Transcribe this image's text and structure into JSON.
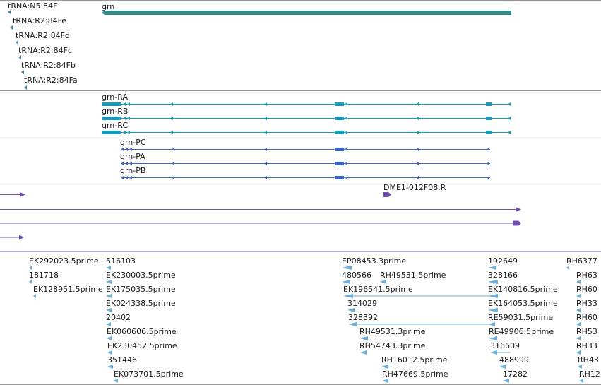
{
  "colors": {
    "trna": "#3a8fa0",
    "gene": "#2f8a8a",
    "transcript_r": "#1a9cb8",
    "transcript_p": "#3b66c0",
    "misc": "#6e4fb0",
    "est": "#6bb0d8",
    "divider": "#9a9a9a"
  },
  "trna_features": [
    {
      "label": "tRNA:N5:84F"
    },
    {
      "label": "tRNA:R2:84Fe"
    },
    {
      "label": "tRNA:R2:84Fd"
    },
    {
      "label": "tRNA:R2:84Fc"
    },
    {
      "label": "tRNA:R2:84Fb"
    },
    {
      "label": "tRNA:R2:84Fa"
    }
  ],
  "gene": {
    "label": "grn"
  },
  "transcripts_r": [
    {
      "label": "grn-RA"
    },
    {
      "label": "grn-RB"
    },
    {
      "label": "grn-RC"
    }
  ],
  "transcripts_p": [
    {
      "label": "grn-PC"
    },
    {
      "label": "grn-PA"
    },
    {
      "label": "grn-PB"
    }
  ],
  "misc_features": [
    {
      "label": "DME1-012F08.R"
    }
  ],
  "est_labels": [
    "EK292023.5prime",
    "181718",
    "EK128951.5prime",
    "516103",
    "EK230003.5prime",
    "EK175035.5prime",
    "EK024338.5prime",
    "20402",
    "EK060606.5prime",
    "EK230452.5prime",
    "351446",
    "EK073701.5prime",
    "EP08453.3prime",
    "480566",
    "RH49531.5prime",
    "EK196541.5prime",
    "314029",
    "328392",
    "RH49531.3prime",
    "RH54743.3prime",
    "RH16012.5prime",
    "RH47669.5prime",
    "192649",
    "328166",
    "EK140816.5prime",
    "EK164053.5prime",
    "RE59031.5prime",
    "RE49906.5prime",
    "316609",
    "488999",
    "17282",
    "RH6377",
    "RH63",
    "RH60",
    "RH33",
    "RH60",
    "RH53",
    "RH33",
    "RH43",
    "RH12"
  ]
}
